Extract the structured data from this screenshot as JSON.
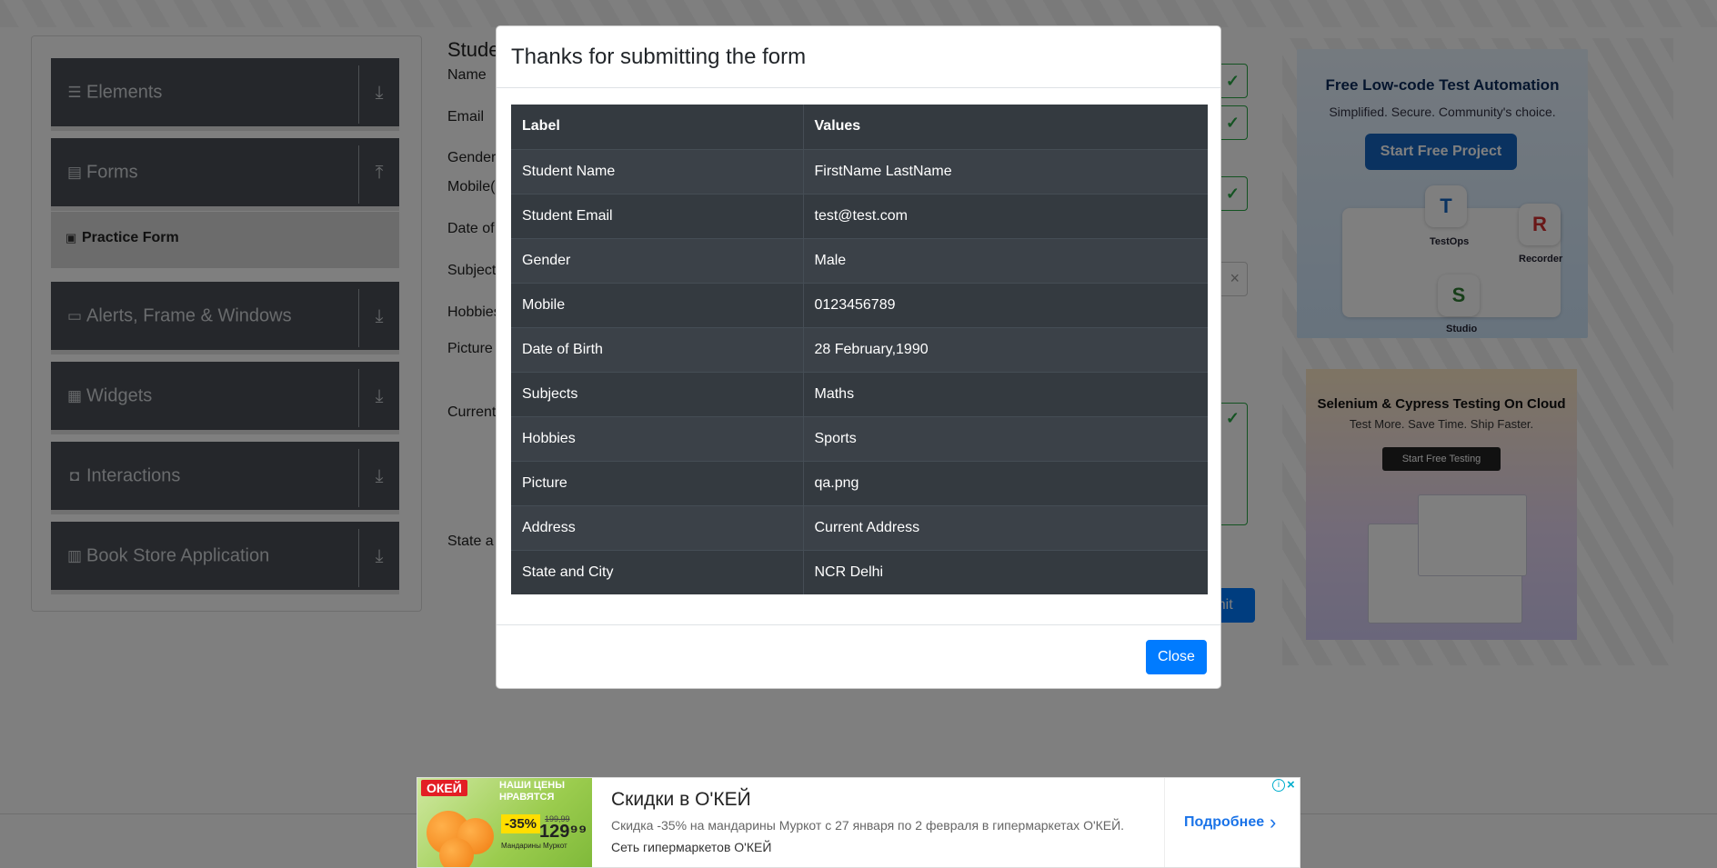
{
  "sidebar": {
    "groups": [
      {
        "label": "Elements",
        "icon": "menu-icon"
      },
      {
        "label": "Forms",
        "icon": "document-icon"
      },
      {
        "label": "Alerts, Frame & Windows",
        "icon": "window-icon"
      },
      {
        "label": "Widgets",
        "icon": "grid-icon"
      },
      {
        "label": "Interactions",
        "icon": "interactions-icon"
      },
      {
        "label": "Book Store Application",
        "icon": "books-icon"
      }
    ],
    "active_item": "Practice Form"
  },
  "form_background": {
    "title_partial": "Stude",
    "labels": {
      "name": "Name",
      "email": "Email",
      "gender": "Gender",
      "mobile": "Mobile(",
      "dob": "Date of",
      "subjects": "Subject",
      "hobbies": "Hobbies",
      "picture": "Picture",
      "current": "Current",
      "state": "State a"
    },
    "submit_partial": "mit"
  },
  "modal": {
    "title": "Thanks for submitting the form",
    "table": {
      "headers": [
        "Label",
        "Values"
      ],
      "rows": [
        [
          "Student Name",
          "FirstName LastName"
        ],
        [
          "Student Email",
          "test@test.com"
        ],
        [
          "Gender",
          "Male"
        ],
        [
          "Mobile",
          "0123456789"
        ],
        [
          "Date of Birth",
          "28 February,1990"
        ],
        [
          "Subjects",
          "Maths"
        ],
        [
          "Hobbies",
          "Sports"
        ],
        [
          "Picture",
          "qa.png"
        ],
        [
          "Address",
          "Current Address"
        ],
        [
          "State and City",
          "NCR Delhi"
        ]
      ]
    },
    "close_label": "Close"
  },
  "ads": {
    "right1": {
      "headline": "Free Low-code Test Automation",
      "subline": "Simplified. Secure. Community's choice.",
      "button": "Start Free Project",
      "tiles": [
        "TestOps",
        "Recorder",
        "Studio"
      ]
    },
    "right2": {
      "headline": "Selenium & Cypress Testing On Cloud",
      "subline": "Test More. Save Time. Ship Faster.",
      "button": "Start Free Testing"
    },
    "banner": {
      "brand": "ОКЕЙ",
      "promo": "НАШИ ЦЕНЫ НРАВЯТСЯ",
      "discount": "-35%",
      "old_price": "199,99",
      "new_price": "129⁹⁹",
      "product": "Мандарины Муркот",
      "title": "Скидки в О'КЕЙ",
      "description": "Скидка -35% на мандарины Муркот с 27 января по 2 февраля в гипермаркетах О'КЕЙ.",
      "advertiser": "Сеть гипермаркетов О'КЕЙ",
      "cta": "Подробнее"
    }
  },
  "colors": {
    "sidebar_bg": "#4a4f56",
    "modal_table_bg": "#343a40",
    "primary": "#007bff",
    "valid": "#28a745"
  }
}
